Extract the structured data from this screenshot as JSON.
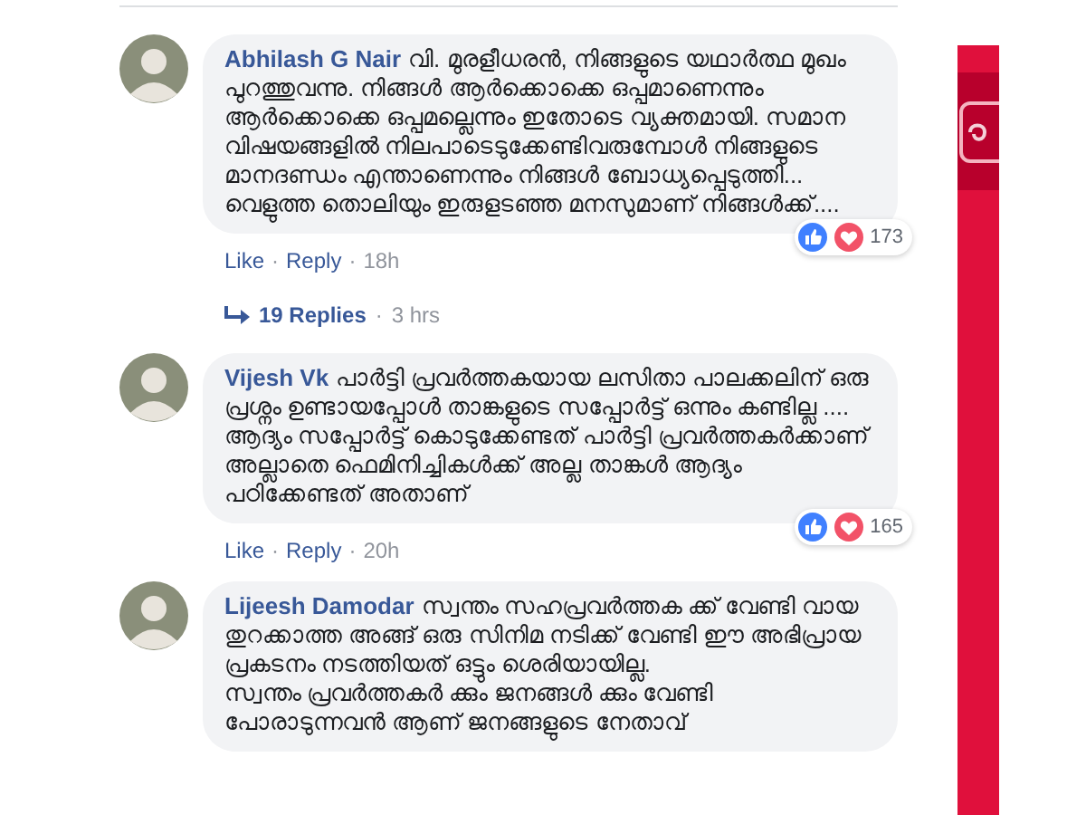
{
  "comments": [
    {
      "author": "Abhilash G Nair",
      "paragraphs": [
        "വി. മുരളീധരൻ, നിങ്ങളുടെ യഥാർത്ഥ മുഖം പുറത്തുവന്നു. നിങ്ങൾ ആർക്കൊക്കെ ഒപ്പമാണെന്നും ആർക്കൊക്കെ ഒപ്പമല്ലെന്നും ഇതോടെ വ്യക്തമായി. സമാന വിഷയങ്ങളിൽ നിലപാടെടുക്കേണ്ടിവരുമ്പോൾ നിങ്ങളുടെ മാനദണ്ഡം എന്താണെന്നും നിങ്ങൾ ബോധ്യപ്പെടുത്തി... വെളുത്ത തൊലിയും ഇരുളടഞ്ഞ മനസുമാണ് നിങ്ങൾക്ക്...."
      ],
      "reaction_count": "173",
      "meta": [
        {
          "kind": "link",
          "text": "Like"
        },
        {
          "kind": "dot",
          "text": "·"
        },
        {
          "kind": "link",
          "text": "Reply"
        },
        {
          "kind": "dot",
          "text": "·"
        },
        {
          "kind": "time",
          "text": "18h"
        }
      ],
      "replies": [
        {
          "kind": "link",
          "text": "19 Replies"
        },
        {
          "kind": "dot",
          "text": "·"
        },
        {
          "kind": "time",
          "text": "3 hrs"
        }
      ]
    },
    {
      "author": "Vijesh Vk",
      "paragraphs": [
        "പാർട്ടി പ്രവർത്തകയായ ലസിതാ പാലക്കലിന് ഒരു പ്രശ്നം ഉണ്ടായപ്പോൾ താങ്കളുടെ സപ്പോർട്ട് ഒന്നും കണ്ടില്ല ....",
        "ആദ്യം സപ്പോർട്ട് കൊടുക്കേണ്ടത് പാർട്ടി പ്രവർത്തകർക്കാണ് അല്ലാതെ ഫെമിനിച്ചികൾക്ക് അല്ല താങ്കൾ ആദ്യം പഠിക്കേണ്ടത് അതാണ്"
      ],
      "reaction_count": "165",
      "meta": [
        {
          "kind": "link",
          "text": "Like"
        },
        {
          "kind": "dot",
          "text": "·"
        },
        {
          "kind": "link",
          "text": "Reply"
        },
        {
          "kind": "dot",
          "text": "·"
        },
        {
          "kind": "time",
          "text": "20h"
        }
      ]
    },
    {
      "author": "Lijeesh Damodar",
      "paragraphs": [
        "സ്വന്തം സഹപ്രവർത്തക ക്ക് വേണ്ടി വായ തുറക്കാത്ത അങ്ങ് ഒരു സിനിമ നടിക്ക് വേണ്ടി ഈ അഭിപ്രായ പ്രകടനം നടത്തിയത് ഒട്ടും ശെരിയായില്ല.",
        "സ്വന്തം പ്രവർത്തകർ ക്കും ജനങ്ങൾ ക്കും വേണ്ടി പോരാടുന്നവൻ ആണ് ജനങ്ങളുടെ നേതാവ്"
      ]
    }
  ]
}
